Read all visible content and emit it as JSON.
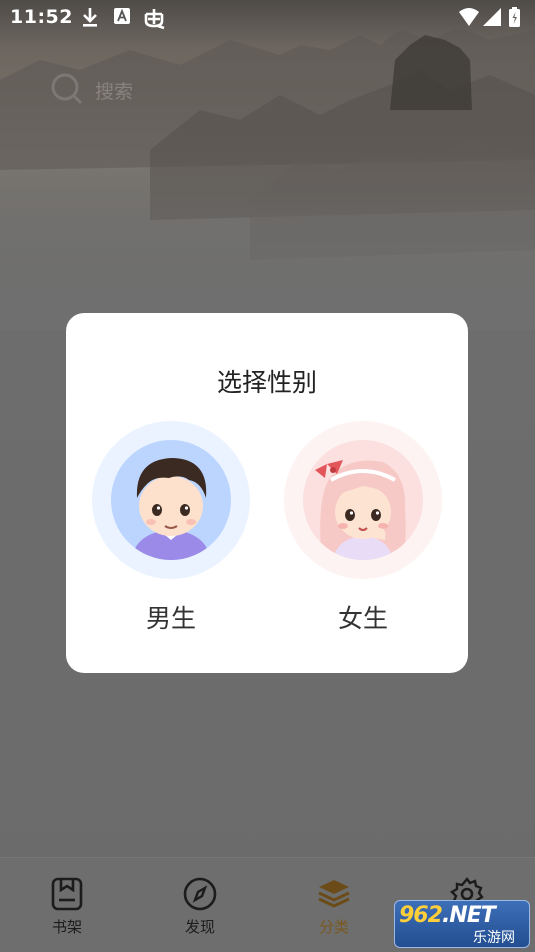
{
  "status_bar": {
    "time": "11:52",
    "left_icons": [
      "download-icon",
      "a-badge-icon",
      "bug-icon"
    ],
    "right_icons": [
      "wifi-icon",
      "signal-icon",
      "battery-icon"
    ]
  },
  "search": {
    "placeholder": "搜索",
    "icon": "search-icon"
  },
  "dialog": {
    "title": "选择性别",
    "options": [
      {
        "label": "男生",
        "avatar": "boy-avatar",
        "halo_color": "#eaf3ff"
      },
      {
        "label": "女生",
        "avatar": "girl-avatar",
        "halo_color": "#fdf3f2"
      }
    ]
  },
  "tabbar": {
    "tabs": [
      {
        "label": "书架",
        "icon": "bookshelf-icon",
        "active": false
      },
      {
        "label": "发现",
        "icon": "compass-icon",
        "active": false
      },
      {
        "label": "分类",
        "icon": "layers-icon",
        "active": true
      },
      {
        "label": "",
        "icon": "gear-icon",
        "active": false
      }
    ]
  },
  "watermark": {
    "top_number": "962",
    "top_suffix": ".NET",
    "bottom": "乐游网"
  },
  "colors": {
    "overlay": "#6f6f6f",
    "dialog_bg": "#ffffff",
    "active_tab": "#7a5a20",
    "boy_shirt": "#9b8ae8",
    "girl_hair": "#f6c9c6"
  }
}
